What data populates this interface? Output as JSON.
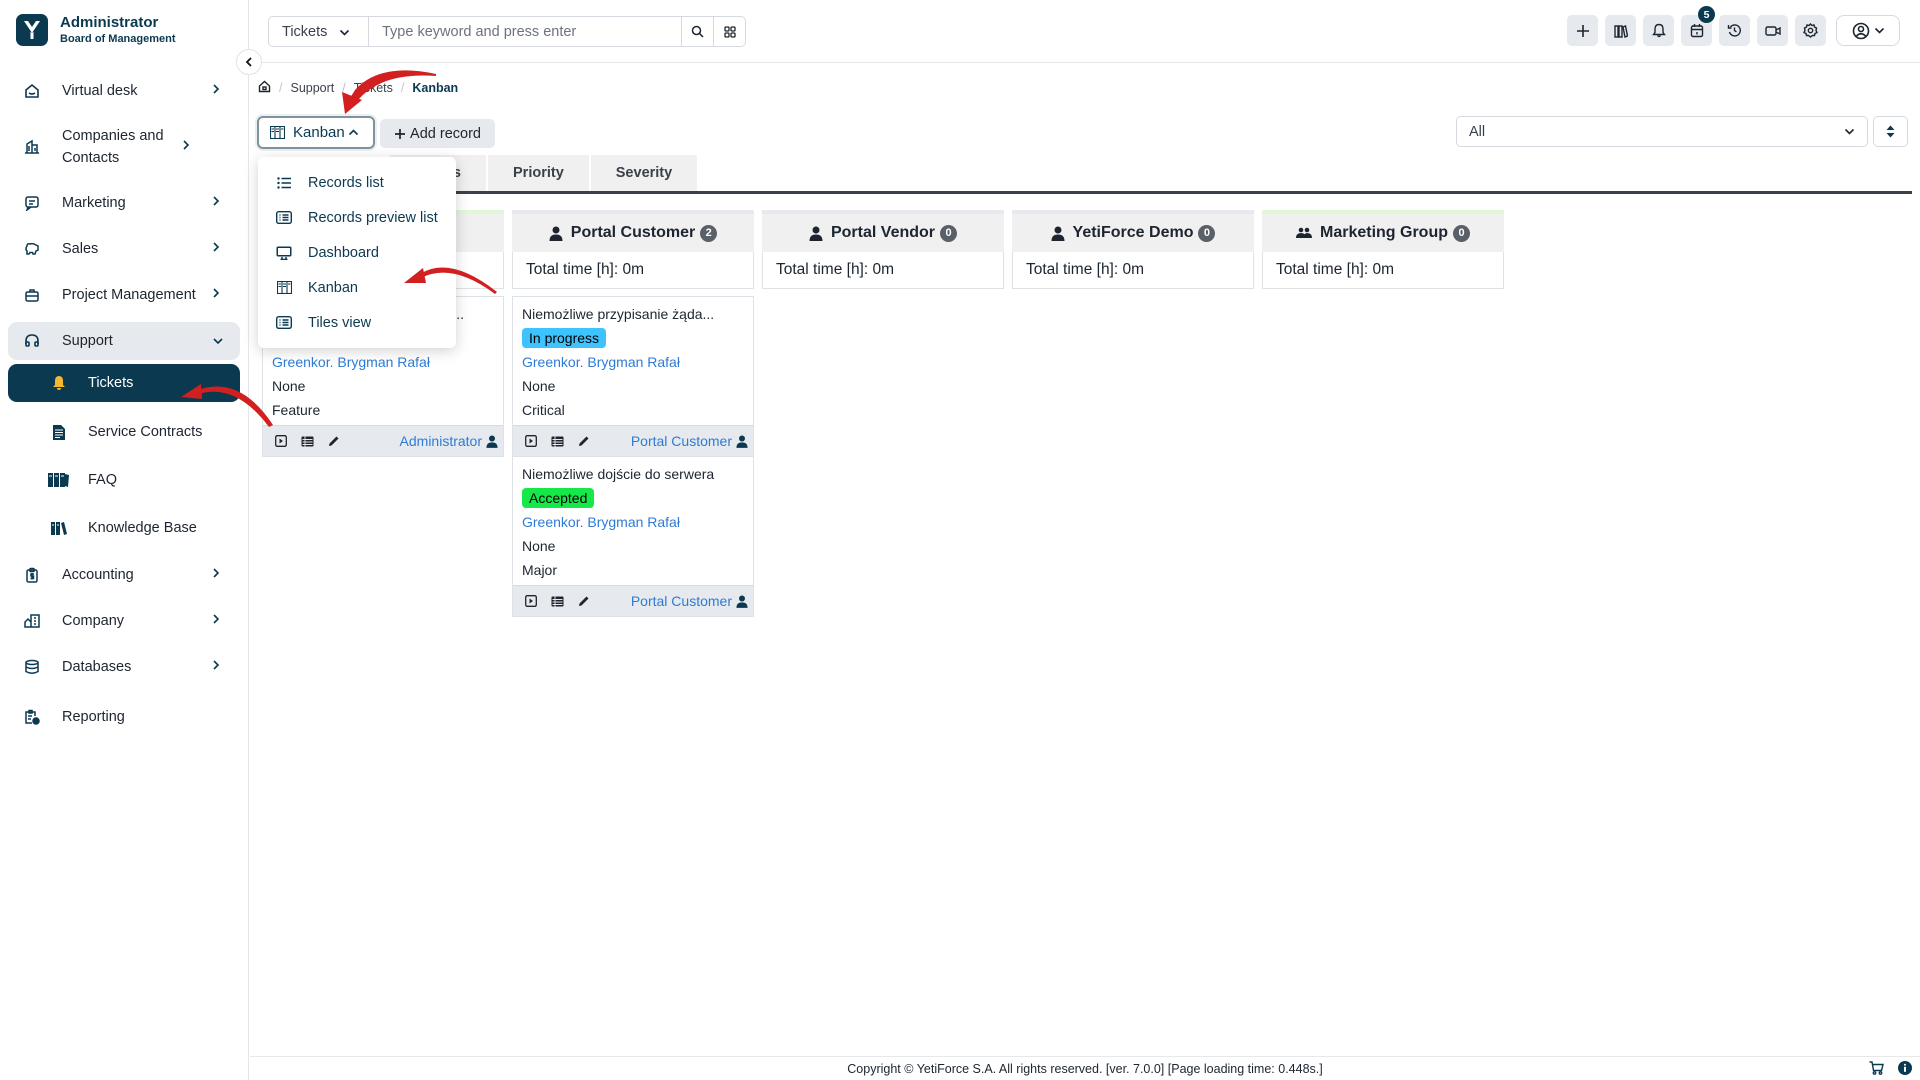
{
  "brand": {
    "title": "Administrator",
    "subtitle": "Board of Management"
  },
  "sidebar": {
    "items": [
      {
        "label": "Virtual desk",
        "icon": "home-icon",
        "has_chevron": true
      },
      {
        "label": "Companies and Contacts",
        "icon": "building-icon",
        "has_chevron": true
      },
      {
        "label": "Marketing",
        "icon": "message-icon",
        "has_chevron": true
      },
      {
        "label": "Sales",
        "icon": "piggy-bank-icon",
        "has_chevron": true
      },
      {
        "label": "Project Management",
        "icon": "briefcase-icon",
        "has_chevron": true
      },
      {
        "label": "Support",
        "icon": "headset-icon",
        "expanded": true
      },
      {
        "label": "Accounting",
        "icon": "clipboard-dollar-icon",
        "has_chevron": true
      },
      {
        "label": "Company",
        "icon": "office-building-icon",
        "has_chevron": true
      },
      {
        "label": "Databases",
        "icon": "database-icon",
        "has_chevron": true
      },
      {
        "label": "Reporting",
        "icon": "report-icon",
        "has_chevron": false
      }
    ],
    "support_children": [
      {
        "label": "Tickets",
        "icon": "bell-icon",
        "active": true
      },
      {
        "label": "Service Contracts",
        "icon": "document-icon"
      },
      {
        "label": "FAQ",
        "icon": "binders-icon"
      },
      {
        "label": "Knowledge Base",
        "icon": "books-icon"
      }
    ]
  },
  "topbar": {
    "module_select": "Tickets",
    "search_placeholder": "Type keyword and press enter",
    "calendar_badge": "5",
    "icons": [
      "plus-icon",
      "library-icon",
      "bell-icon",
      "calendar-icon",
      "history-icon",
      "video-icon",
      "settings-icon",
      "user-circle-icon"
    ]
  },
  "breadcrumb": {
    "items": [
      "Support",
      "Tickets"
    ],
    "current": "Kanban"
  },
  "toolbar": {
    "view_label": "Kanban",
    "add_record_label": "Add record",
    "filter_value": "All"
  },
  "view_menu": {
    "items": [
      {
        "label": "Records list",
        "icon": "list-icon"
      },
      {
        "label": "Records preview list",
        "icon": "preview-list-icon"
      },
      {
        "label": "Dashboard",
        "icon": "monitor-icon"
      },
      {
        "label": "Kanban",
        "icon": "kanban-icon"
      },
      {
        "label": "Tiles view",
        "icon": "tiles-icon"
      }
    ]
  },
  "tabs": [
    {
      "label": "",
      "active": true
    },
    {
      "label": "Status"
    },
    {
      "label": "Priority"
    },
    {
      "label": "Severity"
    }
  ],
  "kanban": {
    "time_label": "Total time [h]: 0m",
    "columns": [
      {
        "name": "",
        "count": "",
        "total_time": "Total time [h]: 0m"
      },
      {
        "name": "Portal Customer",
        "count": "2",
        "total_time": "Total time [h]: 0m"
      },
      {
        "name": "Portal Vendor",
        "count": "0",
        "total_time": "Total time [h]: 0m"
      },
      {
        "name": "YetiForce Demo",
        "count": "0",
        "total_time": "Total time [h]: 0m"
      },
      {
        "name": "Marketing Group",
        "count": "0",
        "total_time": "Total time [h]: 0m"
      }
    ],
    "cards": [
      {
        "column": 0,
        "title": "...",
        "account": "Greenkor. Brygman Rafał",
        "priority": "None",
        "category": "Feature",
        "owner": "Administrator"
      },
      {
        "column": 1,
        "title": "Niemożliwe przypisanie żąda...",
        "status": "In progress",
        "status_color": "#3fc3ff",
        "account": "Greenkor. Brygman Rafał",
        "priority": "None",
        "severity": "Critical",
        "owner": "Portal Customer"
      },
      {
        "column": 1,
        "title": "Niemożliwe dojście do serwera",
        "status": "Accepted",
        "status_color": "#17e84a",
        "account": "Greenkor. Brygman Rafał",
        "priority": "None",
        "severity": "Major",
        "owner": "Portal Customer"
      }
    ]
  },
  "footer": {
    "text": "Copyright © YetiForce S.A. All rights reserved. [ver. 7.0.0] [Page loading time: 0.448s.]"
  },
  "colors": {
    "brand": "#0b3950",
    "link": "#2e7cd6",
    "annotation_arrow": "#d21f1f"
  }
}
